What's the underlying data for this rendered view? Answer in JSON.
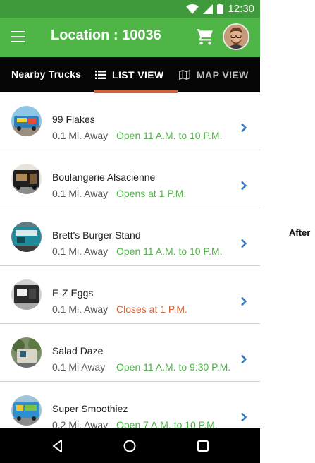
{
  "status_bar": {
    "time": "12:30"
  },
  "app_bar": {
    "title": "Location : 10036"
  },
  "tabs": {
    "section_label": "Nearby Trucks",
    "list_view": "LIST VIEW",
    "map_view": "MAP VIEW",
    "indicator_color": "#d4623a"
  },
  "colors": {
    "open": "#4eb546",
    "closes": "#d4623a",
    "appbar": "#4eb546"
  },
  "trucks": [
    {
      "name": "99 Flakes",
      "distance": "0.1 Mi. Away",
      "hours": "Open 11 A.M. to 10 P.M.",
      "status": "open"
    },
    {
      "name": "Boulangerie Alsacienne",
      "distance": "0.1 Mi. Away",
      "hours": "Opens at 1 P.M.",
      "status": "open"
    },
    {
      "name": "Brett's Burger Stand",
      "distance": "0.1 Mi. Away",
      "hours": "Open 11 A.M. to 10 P.M.",
      "status": "open"
    },
    {
      "name": "E-Z Eggs",
      "distance": "0.1 Mi. Away",
      "hours": "Closes at 1 P.M.",
      "status": "closes"
    },
    {
      "name": "Salad Daze",
      "distance": "0.1 Mi Away",
      "hours": "Open 11 A.M. to 9:30 P.M.",
      "status": "open"
    },
    {
      "name": "Super Smoothiez",
      "distance": "0.2 Mi. Away",
      "hours": "Open 7 A.M. to 10 P.M.",
      "status": "open"
    }
  ],
  "side_label": "After"
}
